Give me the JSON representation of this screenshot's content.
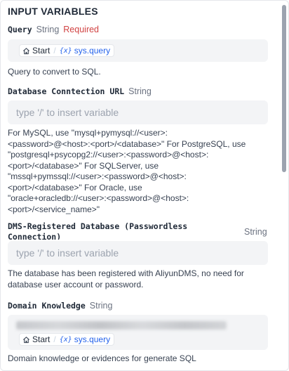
{
  "section": {
    "title": "INPUT VARIABLES"
  },
  "query": {
    "name": "Query",
    "type": "String",
    "required": "Required",
    "chip": {
      "node": "Start",
      "variable": "sys.query"
    },
    "description": "Query to convert to SQL."
  },
  "db_url": {
    "name": "Database Conntection URL",
    "type": "String",
    "placeholder": "type '/' to insert variable",
    "description_lines": [
      "For MySQL, use \"mysql+pymysql://<user>:",
      "<password>@<host>:<port>/<database>\" For PostgreSQL, use",
      "\"postgresql+psycopg2://<user>:<password>@<host>:",
      "<port>/<database>\" For SQLServer, use",
      "\"mssql+pymssql://<user>:<password>@<host>:",
      "<port>/<database>\" For Oracle, use",
      "\"oracle+oracledb://<user>:<password>@<host>:",
      "<port>/<service_name>\""
    ]
  },
  "dms": {
    "name_line1": "DMS-Registered Database (Passwordless",
    "name_line2": "Connection)",
    "type": "String",
    "placeholder": "type '/' to insert variable",
    "description_lines": [
      "The database has been registered with AliyunDMS, no need for",
      "database user account or password."
    ]
  },
  "domain": {
    "name": "Domain Knowledge",
    "type": "String",
    "chip": {
      "node": "Start",
      "variable": "sys.query"
    },
    "description": "Domain knowledge or evidences for generate SQL"
  },
  "icons": {
    "home": "home-icon",
    "variable": "variable-icon"
  },
  "colors": {
    "required": "#d14343",
    "link": "#2563eb",
    "input_bg": "#f3f4f6"
  }
}
